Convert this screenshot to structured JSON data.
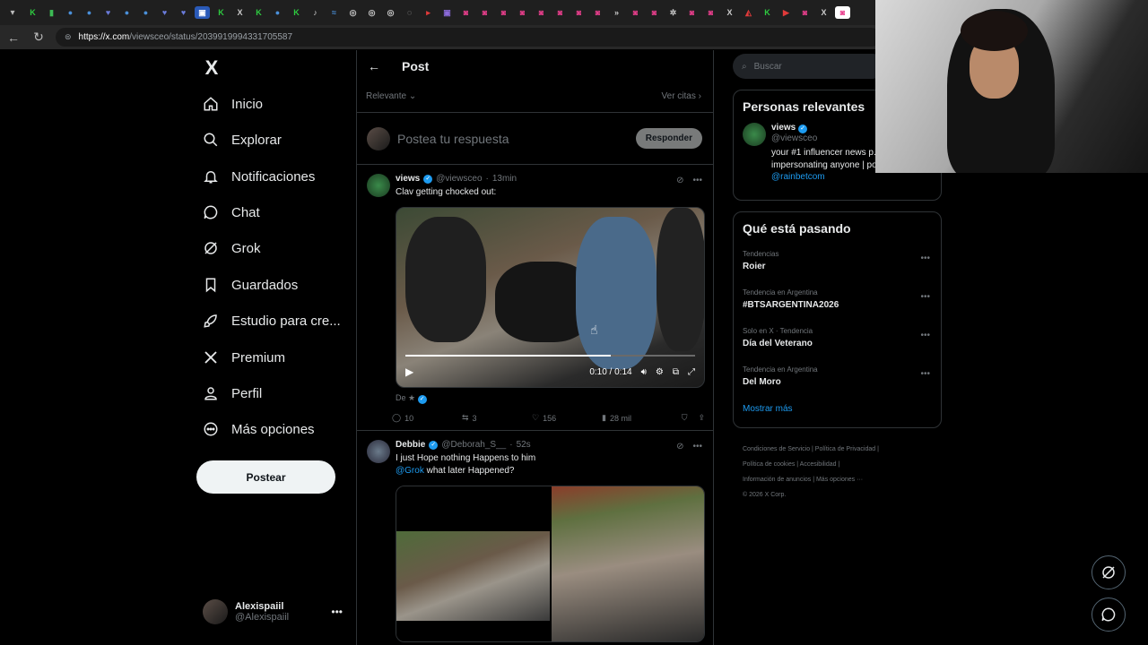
{
  "browser": {
    "url_host": "https://x.com",
    "url_path": "/viewsceo/status/2039919994331705587"
  },
  "nav": {
    "logo": "X",
    "items": [
      {
        "label": "Inicio"
      },
      {
        "label": "Explorar"
      },
      {
        "label": "Notificaciones"
      },
      {
        "label": "Chat"
      },
      {
        "label": "Grok"
      },
      {
        "label": "Guardados"
      },
      {
        "label": "Estudio para cre..."
      },
      {
        "label": "Premium"
      },
      {
        "label": "Perfil"
      },
      {
        "label": "Más opciones"
      }
    ],
    "post_button": "Postear",
    "account": {
      "name": "Alexispaiil",
      "handle": "@Alexispaiil"
    }
  },
  "header": {
    "title": "Post"
  },
  "sort": {
    "relevance": "Relevante",
    "quotes": "Ver citas"
  },
  "reply": {
    "placeholder": "Postea tu respuesta",
    "button": "Responder"
  },
  "tweets": [
    {
      "name": "views",
      "handle": "@viewsceo",
      "time": "13min",
      "text": "Clav getting chocked out:",
      "video": {
        "time": "0:10 / 0:14",
        "progress": 0.71
      },
      "source": "De",
      "stats": {
        "replies": "10",
        "reposts": "3",
        "likes": "156",
        "views": "28 mil"
      }
    },
    {
      "name": "Debbie",
      "handle": "@Deborah_S__",
      "time": "52s",
      "text": "I just Hope nothing Happens to him",
      "mention": "@Grok",
      "text2": "what later Happened?"
    }
  ],
  "search": {
    "placeholder": "Buscar"
  },
  "relevant": {
    "title": "Personas relevantes",
    "name": "views",
    "handle": "@viewsceo",
    "bio": "your #1 influencer news p... impersonating anyone | powered by",
    "bio_link": "@rainbetcom"
  },
  "trending": {
    "title": "Qué está pasando",
    "items": [
      {
        "context": "Tendencias",
        "name": "Roier"
      },
      {
        "context": "Tendencia en Argentina",
        "name": "#BTSARGENTINA2026"
      },
      {
        "context": "Solo en X · Tendencia",
        "name": "Día del Veterano"
      },
      {
        "context": "Tendencia en Argentina",
        "name": "Del Moro"
      }
    ],
    "show_more": "Mostrar más"
  },
  "footer": {
    "line1": "Condiciones de Servicio  |  Política de Privacidad  |",
    "line2": "Política de cookies  |  Accesibilidad  |",
    "line3": "Información de anuncios  |  Más opciones ···",
    "line4": "© 2026 X Corp."
  },
  "colors": {
    "accent": "#1d9bf0",
    "bg": "#000000",
    "muted": "#71767b"
  }
}
